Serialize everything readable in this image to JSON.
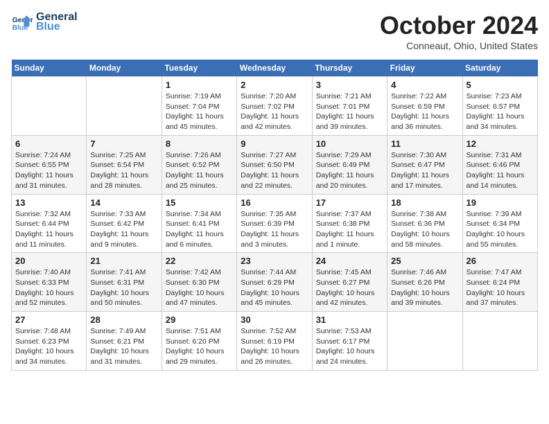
{
  "header": {
    "logo_line1": "General",
    "logo_line2": "Blue",
    "month_title": "October 2024",
    "location": "Conneaut, Ohio, United States"
  },
  "weekdays": [
    "Sunday",
    "Monday",
    "Tuesday",
    "Wednesday",
    "Thursday",
    "Friday",
    "Saturday"
  ],
  "weeks": [
    [
      {
        "day": "",
        "detail": ""
      },
      {
        "day": "",
        "detail": ""
      },
      {
        "day": "1",
        "detail": "Sunrise: 7:19 AM\nSunset: 7:04 PM\nDaylight: 11 hours and 45 minutes."
      },
      {
        "day": "2",
        "detail": "Sunrise: 7:20 AM\nSunset: 7:02 PM\nDaylight: 11 hours and 42 minutes."
      },
      {
        "day": "3",
        "detail": "Sunrise: 7:21 AM\nSunset: 7:01 PM\nDaylight: 11 hours and 39 minutes."
      },
      {
        "day": "4",
        "detail": "Sunrise: 7:22 AM\nSunset: 6:59 PM\nDaylight: 11 hours and 36 minutes."
      },
      {
        "day": "5",
        "detail": "Sunrise: 7:23 AM\nSunset: 6:57 PM\nDaylight: 11 hours and 34 minutes."
      }
    ],
    [
      {
        "day": "6",
        "detail": "Sunrise: 7:24 AM\nSunset: 6:55 PM\nDaylight: 11 hours and 31 minutes."
      },
      {
        "day": "7",
        "detail": "Sunrise: 7:25 AM\nSunset: 6:54 PM\nDaylight: 11 hours and 28 minutes."
      },
      {
        "day": "8",
        "detail": "Sunrise: 7:26 AM\nSunset: 6:52 PM\nDaylight: 11 hours and 25 minutes."
      },
      {
        "day": "9",
        "detail": "Sunrise: 7:27 AM\nSunset: 6:50 PM\nDaylight: 11 hours and 22 minutes."
      },
      {
        "day": "10",
        "detail": "Sunrise: 7:29 AM\nSunset: 6:49 PM\nDaylight: 11 hours and 20 minutes."
      },
      {
        "day": "11",
        "detail": "Sunrise: 7:30 AM\nSunset: 6:47 PM\nDaylight: 11 hours and 17 minutes."
      },
      {
        "day": "12",
        "detail": "Sunrise: 7:31 AM\nSunset: 6:46 PM\nDaylight: 11 hours and 14 minutes."
      }
    ],
    [
      {
        "day": "13",
        "detail": "Sunrise: 7:32 AM\nSunset: 6:44 PM\nDaylight: 11 hours and 11 minutes."
      },
      {
        "day": "14",
        "detail": "Sunrise: 7:33 AM\nSunset: 6:42 PM\nDaylight: 11 hours and 9 minutes."
      },
      {
        "day": "15",
        "detail": "Sunrise: 7:34 AM\nSunset: 6:41 PM\nDaylight: 11 hours and 6 minutes."
      },
      {
        "day": "16",
        "detail": "Sunrise: 7:35 AM\nSunset: 6:39 PM\nDaylight: 11 hours and 3 minutes."
      },
      {
        "day": "17",
        "detail": "Sunrise: 7:37 AM\nSunset: 6:38 PM\nDaylight: 11 hours and 1 minute."
      },
      {
        "day": "18",
        "detail": "Sunrise: 7:38 AM\nSunset: 6:36 PM\nDaylight: 10 hours and 58 minutes."
      },
      {
        "day": "19",
        "detail": "Sunrise: 7:39 AM\nSunset: 6:34 PM\nDaylight: 10 hours and 55 minutes."
      }
    ],
    [
      {
        "day": "20",
        "detail": "Sunrise: 7:40 AM\nSunset: 6:33 PM\nDaylight: 10 hours and 52 minutes."
      },
      {
        "day": "21",
        "detail": "Sunrise: 7:41 AM\nSunset: 6:31 PM\nDaylight: 10 hours and 50 minutes."
      },
      {
        "day": "22",
        "detail": "Sunrise: 7:42 AM\nSunset: 6:30 PM\nDaylight: 10 hours and 47 minutes."
      },
      {
        "day": "23",
        "detail": "Sunrise: 7:44 AM\nSunset: 6:29 PM\nDaylight: 10 hours and 45 minutes."
      },
      {
        "day": "24",
        "detail": "Sunrise: 7:45 AM\nSunset: 6:27 PM\nDaylight: 10 hours and 42 minutes."
      },
      {
        "day": "25",
        "detail": "Sunrise: 7:46 AM\nSunset: 6:26 PM\nDaylight: 10 hours and 39 minutes."
      },
      {
        "day": "26",
        "detail": "Sunrise: 7:47 AM\nSunset: 6:24 PM\nDaylight: 10 hours and 37 minutes."
      }
    ],
    [
      {
        "day": "27",
        "detail": "Sunrise: 7:48 AM\nSunset: 6:23 PM\nDaylight: 10 hours and 34 minutes."
      },
      {
        "day": "28",
        "detail": "Sunrise: 7:49 AM\nSunset: 6:21 PM\nDaylight: 10 hours and 31 minutes."
      },
      {
        "day": "29",
        "detail": "Sunrise: 7:51 AM\nSunset: 6:20 PM\nDaylight: 10 hours and 29 minutes."
      },
      {
        "day": "30",
        "detail": "Sunrise: 7:52 AM\nSunset: 6:19 PM\nDaylight: 10 hours and 26 minutes."
      },
      {
        "day": "31",
        "detail": "Sunrise: 7:53 AM\nSunset: 6:17 PM\nDaylight: 10 hours and 24 minutes."
      },
      {
        "day": "",
        "detail": ""
      },
      {
        "day": "",
        "detail": ""
      }
    ]
  ]
}
